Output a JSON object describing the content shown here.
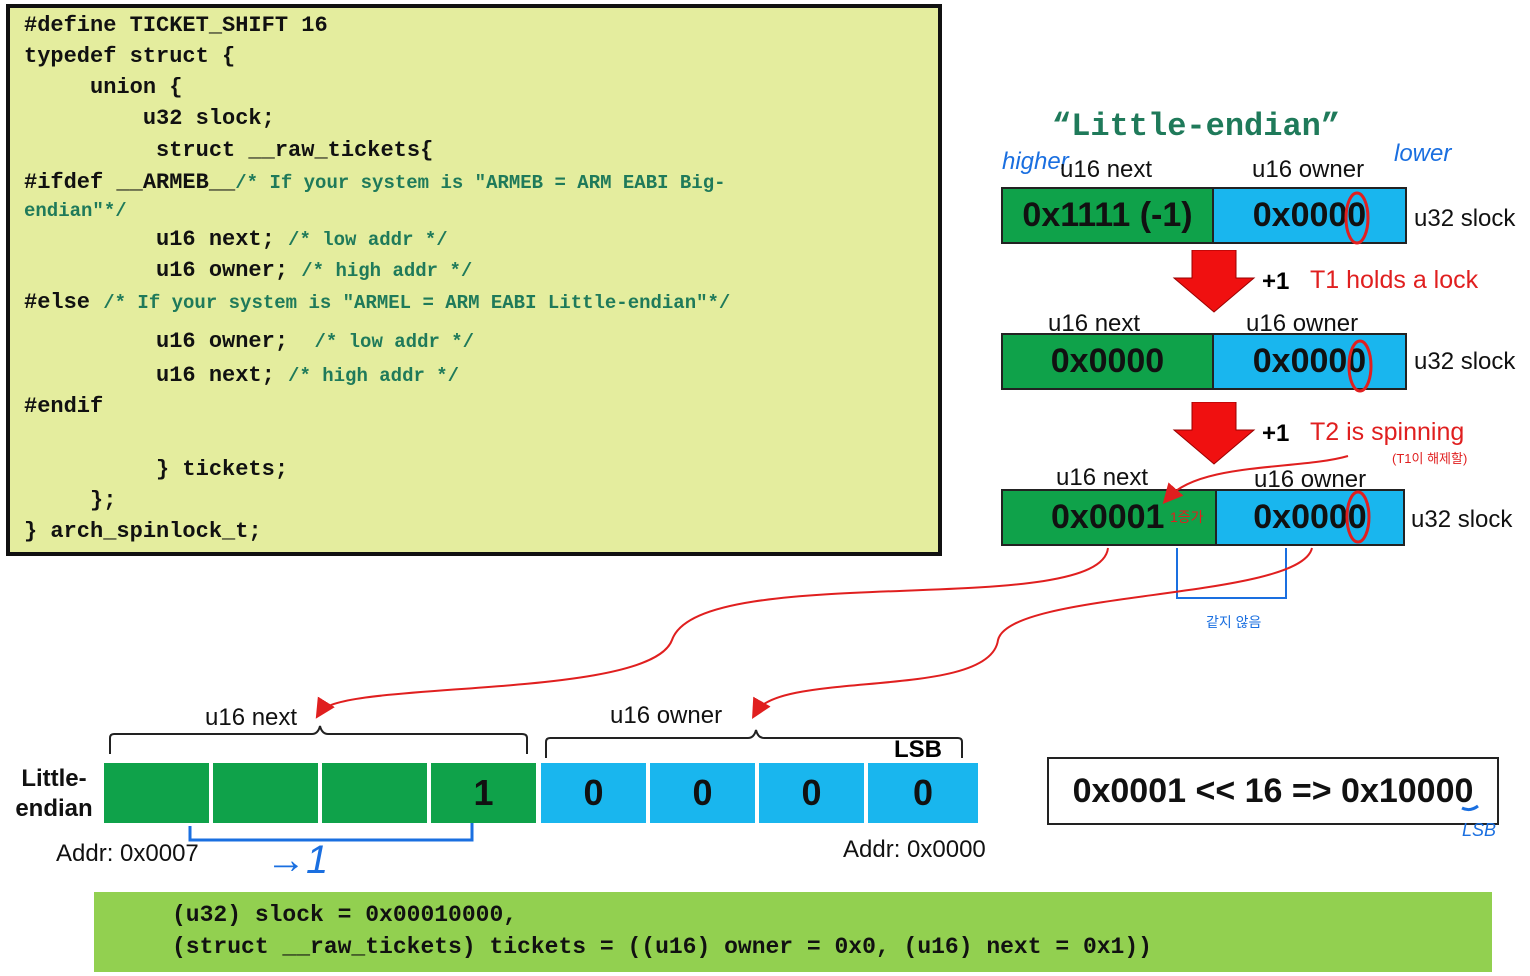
{
  "code": {
    "lines": [
      {
        "code": "#define TICKET_SHIFT 16",
        "comment": ""
      },
      {
        "code": "typedef struct {",
        "comment": ""
      },
      {
        "code": "     union {",
        "comment": ""
      },
      {
        "code": "         u32 slock;",
        "comment": ""
      },
      {
        "code": "          struct __raw_tickets{",
        "comment": ""
      },
      {
        "code": "#ifdef __ARMEB__",
        "comment": "/* If your system is \"ARMEB = ARM EABI Big-"
      },
      {
        "code": "",
        "comment": "endian\"*/"
      },
      {
        "code": "          u16 next; ",
        "comment": "/* low addr */"
      },
      {
        "code": "          u16 owner; ",
        "comment": "/* high addr */"
      },
      {
        "code": "#else ",
        "comment": "/* If your system is \"ARMEL = ARM EABI Little-endian\"*/"
      },
      {
        "code": "          u16 owner;  ",
        "comment": "/* low addr */"
      },
      {
        "code": "          u16 next; ",
        "comment": "/* high addr */"
      },
      {
        "code": "#endif",
        "comment": ""
      },
      {
        "code": "          } tickets;",
        "comment": ""
      },
      {
        "code": "     };",
        "comment": ""
      },
      {
        "code": "} arch_spinlock_t;",
        "comment": ""
      }
    ]
  },
  "diagram": {
    "title": "“Little-endian”",
    "note_higher": "higher",
    "note_lower": "lower",
    "rows": [
      {
        "next_label": "u16 next",
        "owner_label": "u16 owner",
        "next_value": "0x1111 (-1)",
        "owner_value": "0x0000",
        "slock_label": "u32 slock"
      },
      {
        "next_label": "u16 next",
        "owner_label": "u16 owner",
        "next_value": "0x0000",
        "owner_value": "0x0000",
        "slock_label": "u32 slock"
      },
      {
        "next_label": "u16 next",
        "owner_label": "u16 owner",
        "next_value": "0x0001",
        "owner_value": "0x0000",
        "slock_label": "u32 slock"
      }
    ],
    "steps": [
      {
        "plus": "+1",
        "text": "T1 holds a lock"
      },
      {
        "plus": "+1",
        "text": "T2 is spinning"
      }
    ],
    "note_spin": "(T1이 해제할)",
    "note_one": "1증가",
    "note_below": "같지 않음"
  },
  "memory": {
    "row_label_line1": "Little-",
    "row_label_line2": "endian",
    "next_label": "u16 next",
    "owner_label": "u16 owner",
    "lsb_label": "LSB",
    "cells": [
      "",
      "",
      "",
      "1",
      "0",
      "0",
      "0",
      "0"
    ],
    "addr_high": "Addr: 0x0007",
    "addr_low": "Addr: 0x0000",
    "handwritten_arrow": "→1"
  },
  "shift": {
    "expression": "0x0001 << 16 => 0x10000",
    "note": "LSB"
  },
  "summary": {
    "line1": "(u32) slock = 0x00010000,",
    "line2": "(struct __raw_tickets) tickets = ((u16) owner = 0x0, (u16) next = 0x1))"
  },
  "colors": {
    "code_bg": "#e4ed9e",
    "green": "#0fa24a",
    "blue": "#19b6ee",
    "red": "#e01f1f",
    "summary_bg": "#92d050",
    "handwriting": "#1a6fe0"
  }
}
